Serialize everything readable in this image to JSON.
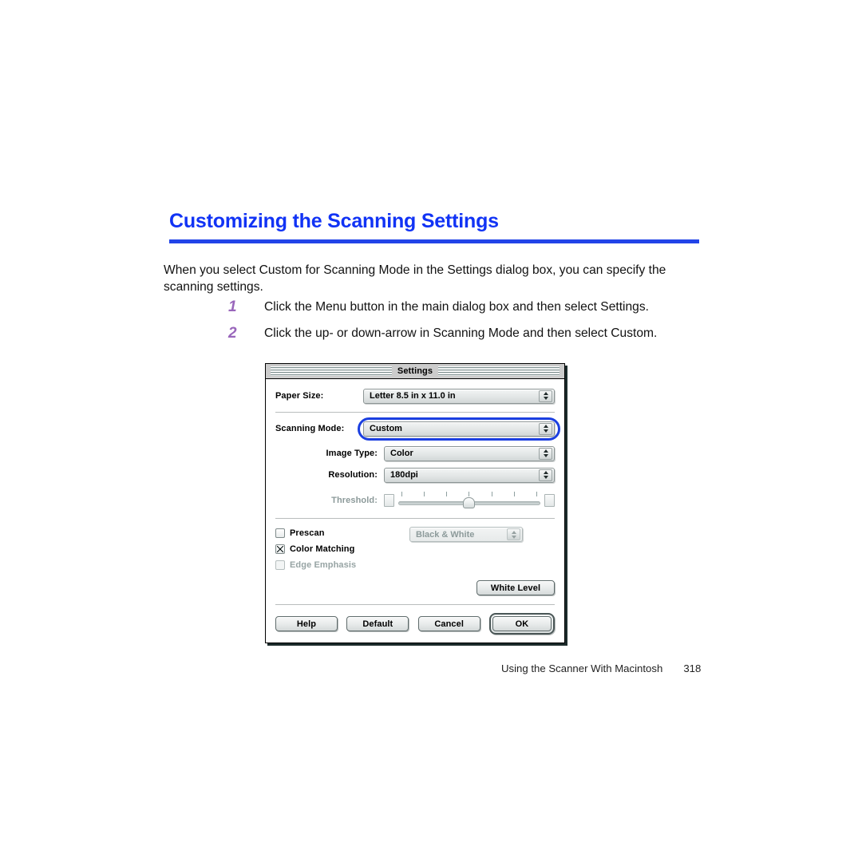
{
  "page": {
    "heading": "Customizing the Scanning Settings",
    "intro": "When you select Custom for Scanning Mode in the Settings dialog box, you can specify the scanning settings.",
    "accent_color": "#1133f5",
    "rule_color": "#2244e8",
    "step_number_color": "#9966bb"
  },
  "steps": [
    {
      "number": "1",
      "text": "Click the Menu button in the main dialog box and then select Settings."
    },
    {
      "number": "2",
      "text": "Click the up- or down-arrow in Scanning Mode and then select Custom."
    }
  ],
  "dialog": {
    "title": "Settings",
    "highlight_color": "#1b3fe0",
    "fields": [
      {
        "label": "Paper Size:",
        "value": "Letter 8.5 in x 11.0 in",
        "enabled": true,
        "highlighted": false
      },
      {
        "label": "Scanning Mode:",
        "value": "Custom",
        "enabled": true,
        "highlighted": true
      },
      {
        "label": "Image Type:",
        "value": "Color",
        "enabled": true,
        "highlighted": false
      },
      {
        "label": "Resolution:",
        "value": "180dpi",
        "enabled": true,
        "highlighted": false
      }
    ],
    "threshold": {
      "label": "Threshold:",
      "enabled": false,
      "tick_count": 7,
      "value_percent": 50
    },
    "checkboxes": [
      {
        "label": "Prescan",
        "checked": false,
        "enabled": true
      },
      {
        "label": "Color Matching",
        "checked": true,
        "enabled": true
      },
      {
        "label": "Edge Emphasis",
        "checked": false,
        "enabled": false
      }
    ],
    "mode_popup": {
      "value": "Black & White",
      "enabled": false
    },
    "white_level_button": "White Level",
    "buttons": [
      {
        "label": "Help",
        "default": false
      },
      {
        "label": "Default",
        "default": false
      },
      {
        "label": "Cancel",
        "default": false
      },
      {
        "label": "OK",
        "default": true
      }
    ]
  },
  "footer": {
    "section": "Using the Scanner With Macintosh",
    "page_number": "318"
  }
}
